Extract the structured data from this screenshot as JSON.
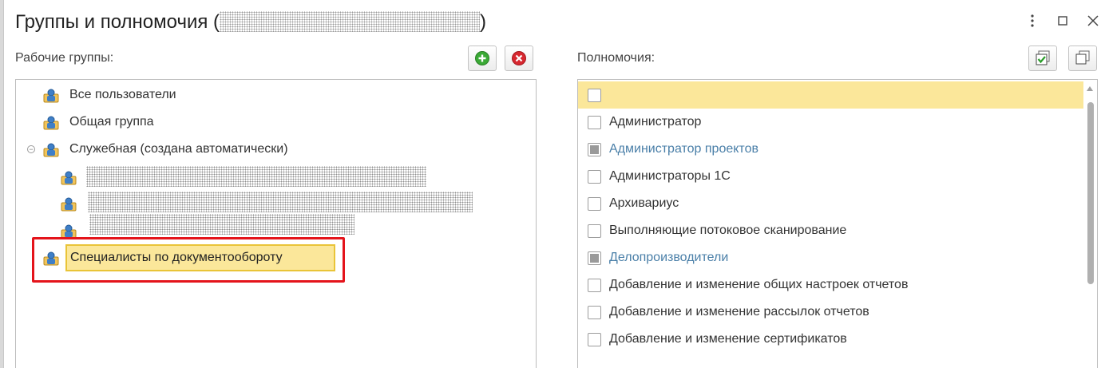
{
  "window": {
    "title_prefix": "Группы и полномочия (",
    "title_suffix": ")"
  },
  "groups_panel": {
    "label": "Рабочие группы:",
    "items": [
      {
        "label": "Все пользователи"
      },
      {
        "label": "Общая группа"
      },
      {
        "label": "Служебная (создана автоматически)"
      }
    ],
    "selected_item": "Специалисты по документообороту"
  },
  "permissions_panel": {
    "label": "Полномочия:",
    "items": [
      {
        "label": "",
        "state": "unchecked",
        "highlight": true
      },
      {
        "label": "Администратор",
        "state": "unchecked"
      },
      {
        "label": "Администратор проектов",
        "state": "partial"
      },
      {
        "label": "Администраторы 1С",
        "state": "unchecked"
      },
      {
        "label": "Архивариус",
        "state": "unchecked"
      },
      {
        "label": "Выполняющие потоковое сканирование",
        "state": "unchecked"
      },
      {
        "label": "Делопроизводители",
        "state": "partial"
      },
      {
        "label": "Добавление и изменение общих настроек отчетов",
        "state": "unchecked"
      },
      {
        "label": "Добавление и изменение рассылок отчетов",
        "state": "unchecked"
      },
      {
        "label": "Добавление и изменение сертификатов",
        "state": "unchecked"
      }
    ]
  },
  "colors": {
    "highlight": "#fbe79a",
    "link_text": "#4a7fa8",
    "red_frame": "#e4141b",
    "add_green": "#3aa935",
    "delete_red": "#d7272f"
  }
}
